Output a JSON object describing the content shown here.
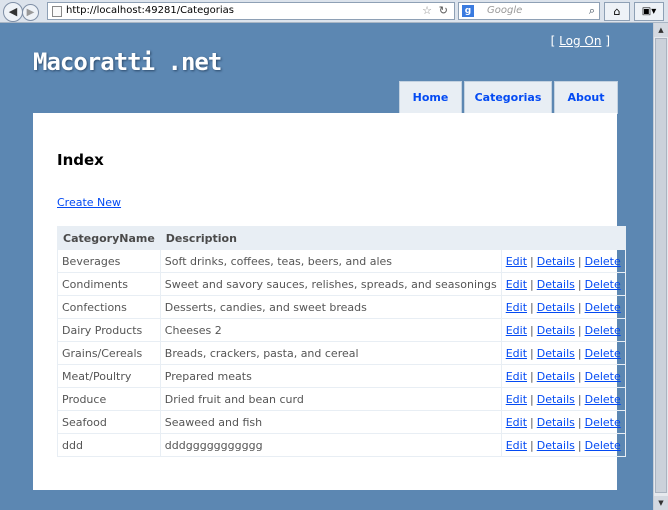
{
  "browser": {
    "url": "http://localhost:49281/Categorias",
    "search_placeholder": "Google"
  },
  "header": {
    "site_title": "Macoratti .net",
    "logon_open": "[",
    "logon_label": "Log On",
    "logon_close": "]"
  },
  "menu": {
    "home": "Home",
    "categorias": "Categorias",
    "about": "About"
  },
  "page": {
    "title": "Index",
    "create_new": "Create New"
  },
  "table": {
    "headers": [
      "CategoryName",
      "Description",
      ""
    ],
    "actions": {
      "edit": "Edit",
      "details": "Details",
      "delete": "Delete",
      "sep": "|"
    },
    "rows": [
      {
        "name": "Beverages",
        "description": "Soft drinks, coffees, teas, beers, and ales"
      },
      {
        "name": "Condiments",
        "description": "Sweet and savory sauces, relishes, spreads, and seasonings"
      },
      {
        "name": "Confections",
        "description": "Desserts, candies, and sweet breads"
      },
      {
        "name": "Dairy Products",
        "description": "Cheeses 2"
      },
      {
        "name": "Grains/Cereals",
        "description": "Breads, crackers, pasta, and cereal"
      },
      {
        "name": "Meat/Poultry",
        "description": "Prepared meats"
      },
      {
        "name": "Produce",
        "description": "Dried fruit and bean curd"
      },
      {
        "name": "Seafood",
        "description": "Seaweed and fish"
      },
      {
        "name": "ddd",
        "description": "dddggggggggggg"
      }
    ]
  },
  "colors": {
    "page_background": "#5c87b2",
    "link": "#034af3",
    "table_header": "#e8eef4"
  }
}
